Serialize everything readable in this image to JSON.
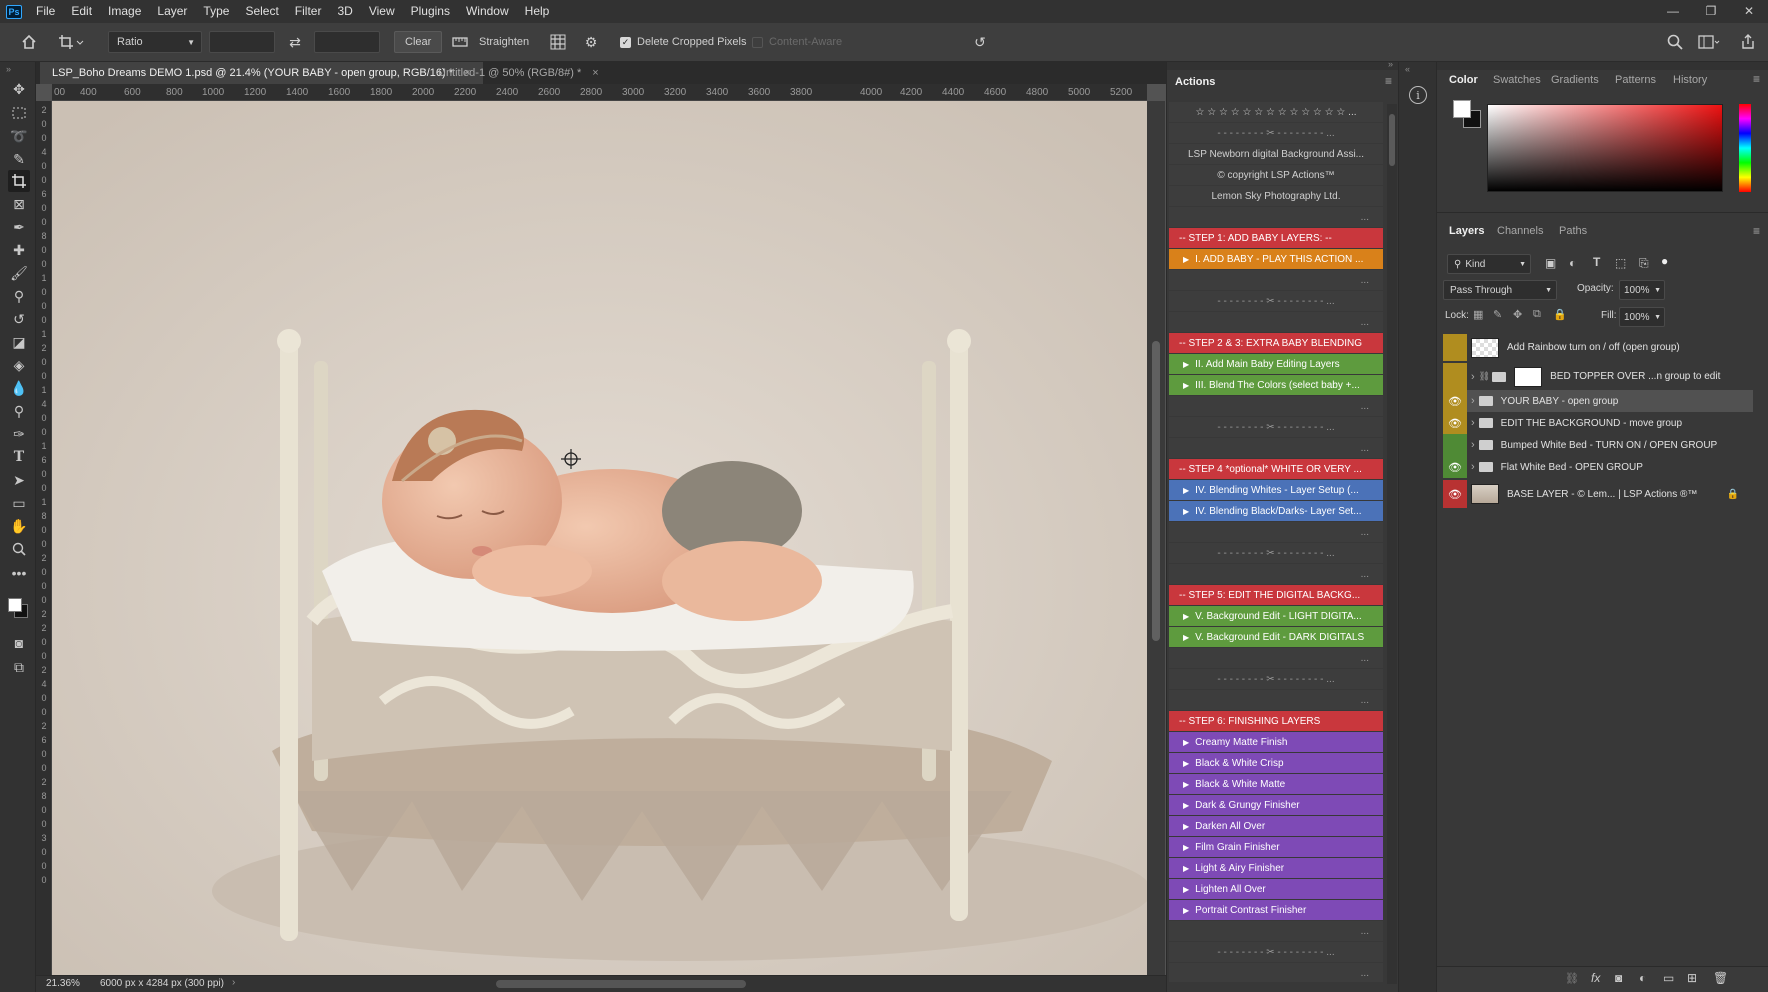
{
  "app": {
    "logo": "Ps"
  },
  "menu": [
    "File",
    "Edit",
    "Image",
    "Layer",
    "Type",
    "Select",
    "Filter",
    "3D",
    "View",
    "Plugins",
    "Window",
    "Help"
  ],
  "window_controls": {
    "minimize": "—",
    "restore": "❐",
    "close": "✕"
  },
  "options_bar": {
    "ratio_select": "Ratio",
    "clear_button": "Clear",
    "straighten_label": "Straighten",
    "delete_cropped_label": "Delete Cropped Pixels",
    "delete_cropped_checked": true,
    "content_aware_label": "Content-Aware",
    "content_aware_checked": false
  },
  "doc_tabs": [
    {
      "label": "LSP_Boho Dreams DEMO 1.psd @ 21.4% (YOUR BABY - open group, RGB/16) *",
      "active": true
    },
    {
      "label": "Untitled-1 @ 50% (RGB/8#) *",
      "active": false
    }
  ],
  "ruler_h_labels": [
    "00",
    "400",
    "600",
    "800",
    "1000",
    "1200",
    "1400",
    "1600",
    "1800",
    "2000",
    "2200",
    "2400",
    "2600",
    "2800",
    "3000",
    "3200",
    "3400",
    "3600",
    "3800",
    "4000",
    "4200",
    "4400",
    "4600",
    "4800",
    "5000",
    "5200"
  ],
  "ruler_v_labels": [
    "2",
    "0",
    "0",
    "4",
    "0",
    "0",
    "6",
    "0",
    "0",
    "8",
    "0",
    "0",
    "1",
    "0",
    "0",
    "0",
    "1",
    "2",
    "0",
    "0",
    "1",
    "4",
    "0",
    "0",
    "1",
    "6",
    "0",
    "0",
    "1",
    "8",
    "0",
    "0",
    "2",
    "0",
    "0",
    "0",
    "2",
    "2",
    "0",
    "0",
    "2",
    "4",
    "0",
    "0",
    "2",
    "6",
    "0",
    "0",
    "2",
    "8",
    "0",
    "0",
    "3",
    "0",
    "0",
    "0"
  ],
  "status": {
    "zoom": "21.36%",
    "doc_info": "6000 px x 4284 px (300 ppi)"
  },
  "actions_panel": {
    "title": "Actions",
    "rows": [
      {
        "kind": "plain",
        "text": "☆ ☆ ☆ ☆ ☆ ☆ ☆ ☆ ☆ ☆ ☆ ☆ ☆ ..."
      },
      {
        "kind": "sep",
        "text": "- - - - - - - - ✂ - - - - - - - - ..."
      },
      {
        "kind": "plain",
        "text": "LSP Newborn digital Background Assi..."
      },
      {
        "kind": "plain",
        "text": "© copyright LSP Actions™"
      },
      {
        "kind": "plain",
        "text": "Lemon Sky Photography Ltd."
      },
      {
        "kind": "dots",
        "text": "..."
      },
      {
        "kind": "red",
        "text": "-- STEP 1: ADD BABY LAYERS: --"
      },
      {
        "kind": "orange",
        "text": "I. ADD BABY - PLAY THIS ACTION ..."
      },
      {
        "kind": "dots",
        "text": "..."
      },
      {
        "kind": "sep",
        "text": "- - - - - - - - ✂ - - - - - - - - ..."
      },
      {
        "kind": "dots",
        "text": "..."
      },
      {
        "kind": "red",
        "text": "-- STEP 2 & 3: EXTRA BABY BLENDING"
      },
      {
        "kind": "green",
        "text": "II.  Add Main Baby Editing Layers"
      },
      {
        "kind": "green",
        "text": "III. Blend The Colors (select baby +..."
      },
      {
        "kind": "dots",
        "text": "..."
      },
      {
        "kind": "sep",
        "text": "- - - - - - - - ✂ - - - - - - - - ..."
      },
      {
        "kind": "dots",
        "text": "..."
      },
      {
        "kind": "red",
        "text": "-- STEP 4 *optional* WHITE OR VERY ..."
      },
      {
        "kind": "blue",
        "text": "IV. Blending Whites - Layer Setup (..."
      },
      {
        "kind": "blue",
        "text": "IV. Blending Black/Darks- Layer Set..."
      },
      {
        "kind": "dots",
        "text": "..."
      },
      {
        "kind": "sep",
        "text": "- - - - - - - - ✂ - - - - - - - - ..."
      },
      {
        "kind": "dots",
        "text": "..."
      },
      {
        "kind": "red",
        "text": "-- STEP 5: EDIT THE DIGITAL BACKG..."
      },
      {
        "kind": "green",
        "text": "V. Background Edit - LIGHT DIGITA..."
      },
      {
        "kind": "green",
        "text": "V. Background Edit - DARK DIGITALS"
      },
      {
        "kind": "dots",
        "text": "..."
      },
      {
        "kind": "sep",
        "text": "- - - - - - - - ✂ - - - - - - - - ..."
      },
      {
        "kind": "dots",
        "text": "..."
      },
      {
        "kind": "red",
        "text": "-- STEP 6: FINISHING LAYERS"
      },
      {
        "kind": "purple",
        "text": "Creamy Matte Finish"
      },
      {
        "kind": "purple",
        "text": "Black & White Crisp"
      },
      {
        "kind": "purple",
        "text": "Black & White Matte"
      },
      {
        "kind": "purple",
        "text": "Dark & Grungy Finisher"
      },
      {
        "kind": "purple",
        "text": "Darken All Over"
      },
      {
        "kind": "purple",
        "text": "Film Grain Finisher"
      },
      {
        "kind": "purple",
        "text": "Light & Airy Finisher"
      },
      {
        "kind": "purple",
        "text": "Lighten All Over"
      },
      {
        "kind": "purple",
        "text": "Portrait Contrast Finisher"
      },
      {
        "kind": "dots",
        "text": "..."
      },
      {
        "kind": "sep",
        "text": "- - - - - - - - ✂ - - - - - - - - ..."
      },
      {
        "kind": "dots",
        "text": "..."
      }
    ]
  },
  "color_panel": {
    "tabs": [
      "Color",
      "Swatches",
      "Gradients",
      "Patterns",
      "History"
    ]
  },
  "layers_panel": {
    "tabs": [
      "Layers",
      "Channels",
      "Paths"
    ],
    "filter_kind": "Kind",
    "blend_mode": "Pass Through",
    "opacity_label": "Opacity:",
    "opacity": "100%",
    "lock_label": "Lock:",
    "fill_label": "Fill:",
    "fill": "100%",
    "layers": [
      {
        "name": "Add Rainbow turn on / off  (open group)",
        "visible": false,
        "color": "#b08d1f",
        "thumb": "checker",
        "group": false
      },
      {
        "name": "BED TOPPER OVER ...n group to edit",
        "visible": false,
        "color": "#b08d1f",
        "thumb": "white",
        "group": true
      },
      {
        "name": "YOUR BABY - open group",
        "visible": true,
        "color": "#b08d1f",
        "thumb": "none",
        "group": true,
        "selected": true
      },
      {
        "name": "EDIT THE BACKGROUND - move group",
        "visible": true,
        "color": "#b08d1f",
        "thumb": "none",
        "group": true
      },
      {
        "name": "Bumped White Bed - TURN ON / OPEN GROUP",
        "visible": false,
        "color": "#4f8a35",
        "thumb": "none",
        "group": true
      },
      {
        "name": "Flat White Bed - OPEN GROUP",
        "visible": true,
        "color": "#4f8a35",
        "thumb": "none",
        "group": true
      },
      {
        "name": "BASE LAYER - © Lem... | LSP Actions ®™",
        "visible": true,
        "color": "#b83232",
        "thumb": "photo",
        "group": false
      }
    ]
  }
}
